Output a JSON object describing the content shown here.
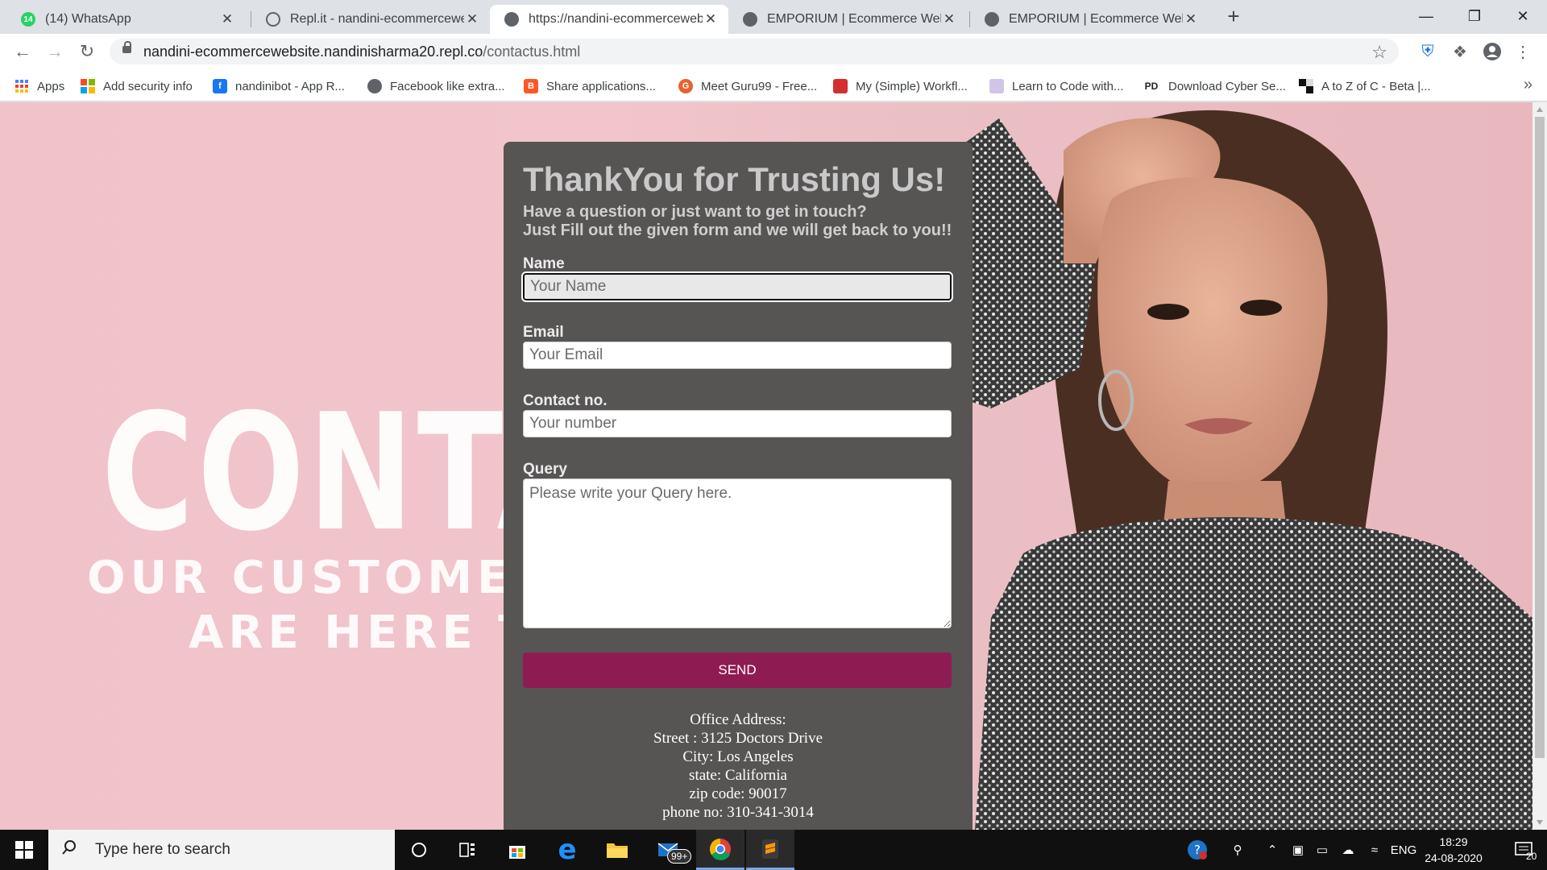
{
  "browser": {
    "tabs": [
      {
        "title": "(14) WhatsApp",
        "favicon_color": "#25d366",
        "badge": "14",
        "active": false
      },
      {
        "title": "Repl.it - nandini-ecommercewebsite",
        "favicon_color": "#5f6368",
        "active": false
      },
      {
        "title": "https://nandini-ecommercewebsite",
        "favicon_color": "#5f6368",
        "active": true
      },
      {
        "title": "EMPORIUM | Ecommerce Website",
        "favicon_color": "#5f6368",
        "active": false
      },
      {
        "title": "EMPORIUM | Ecommerce Website",
        "favicon_color": "#5f6368",
        "active": false
      }
    ],
    "new_tab": "+",
    "url_host": "nandini-ecommercewebsite.nandinisharma20.repl.co",
    "url_path": "/contactus.html",
    "bookmarks": [
      {
        "label": "Apps",
        "icon": "apps-grid-icon",
        "color": "#4285f4"
      },
      {
        "label": "Add security info",
        "icon": "microsoft-icon",
        "color": "#f25022"
      },
      {
        "label": "nandinibot - App R...",
        "icon": "facebook-icon",
        "color": "#1877f2"
      },
      {
        "label": "Facebook like extra...",
        "icon": "globe-icon",
        "color": "#5f6368"
      },
      {
        "label": "Share applications...",
        "icon": "blogger-icon",
        "color": "#ff5722"
      },
      {
        "label": "Meet Guru99 - Free...",
        "icon": "guru99-icon",
        "color": "#e8622c"
      },
      {
        "label": "My (Simple) Workfl...",
        "icon": "workflow-icon",
        "color": "#d32f2f"
      },
      {
        "label": "Learn to Code with...",
        "icon": "code-icon",
        "color": "#b39ddb"
      },
      {
        "label": "Download Cyber Se...",
        "icon": "pd-icon",
        "color": "#222222"
      },
      {
        "label": "A to Z of C - Beta |...",
        "icon": "blocks-icon",
        "color": "#111111"
      }
    ]
  },
  "page": {
    "bg_heading": "CONTAC",
    "bg_line1": "OUR CUSTOMER",
    "bg_line2": "ARE HERE TO",
    "title": "ThankYou for Trusting Us!",
    "subtitle1": "Have a question or just want to get in touch?",
    "subtitle2": "Just Fill out the given form and we will get back to you!!",
    "form": {
      "name_label": "Name",
      "name_placeholder": "Your Name",
      "email_label": "Email",
      "email_placeholder": "Your Email",
      "contact_label": "Contact no.",
      "contact_placeholder": "Your number",
      "query_label": "Query",
      "query_placeholder": "Please write your Query here.",
      "send_label": "SEND"
    },
    "address": {
      "heading": "Office Address:",
      "street": "Street : 3125 Doctors Drive",
      "city": "City: Los Angeles",
      "state": "state: California",
      "zip": "zip code: 90017",
      "phone": "phone no: 310-341-3014"
    }
  },
  "taskbar": {
    "search_placeholder": "Type here to search",
    "mail_badge": "99+",
    "language": "ENG",
    "time": "18:29",
    "date": "24-08-2020",
    "notifications": "20"
  },
  "colors": {
    "send_button": "#8f1b53",
    "card_bg": "#575454",
    "page_bg": "#efc3c9"
  }
}
